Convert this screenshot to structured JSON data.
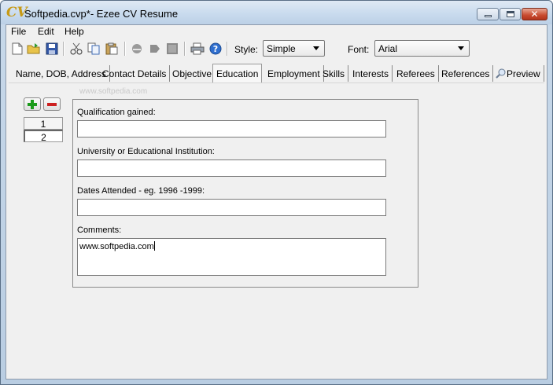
{
  "window": {
    "title": "Softpedia.cvp*- Ezee CV Resume",
    "app_icon_text": "CV"
  },
  "menu": [
    "File",
    "Edit",
    "Help"
  ],
  "toolbar": {
    "style_label": "Style:",
    "style_value": "Simple",
    "font_label": "Font:",
    "font_value": "Arial",
    "icons": [
      "new-file-icon",
      "open-folder-icon",
      "save-icon",
      "cut-icon",
      "copy-icon",
      "paste-icon",
      "internet-explorer-icon",
      "export-icon",
      "grid-icon",
      "print-icon",
      "help-icon"
    ]
  },
  "tabs": [
    {
      "label": "Name, DOB, Address"
    },
    {
      "label": "Contact Details"
    },
    {
      "label": "Objective"
    },
    {
      "label": "Education",
      "active": true
    },
    {
      "label": "Employment"
    },
    {
      "label": "Skills"
    },
    {
      "label": "Interests"
    },
    {
      "label": "Referees"
    },
    {
      "label": "References"
    },
    {
      "label": "Preview"
    }
  ],
  "watermark": "www.softpedia.com",
  "records": {
    "items": [
      "1",
      "2"
    ],
    "selected": "2"
  },
  "education_form": {
    "qualification_label": "Qualification gained:",
    "qualification_value": "",
    "institution_label": "University or Educational Institution:",
    "institution_value": "",
    "dates_label": "Dates Attended - eg. 1996 -1999:",
    "dates_value": "",
    "comments_label": "Comments:",
    "comments_value": "www.softpedia.com"
  },
  "colors": {
    "add_green": "#1a9a1a",
    "remove_red": "#cc1f1f",
    "close_red": "#c94b2f"
  }
}
